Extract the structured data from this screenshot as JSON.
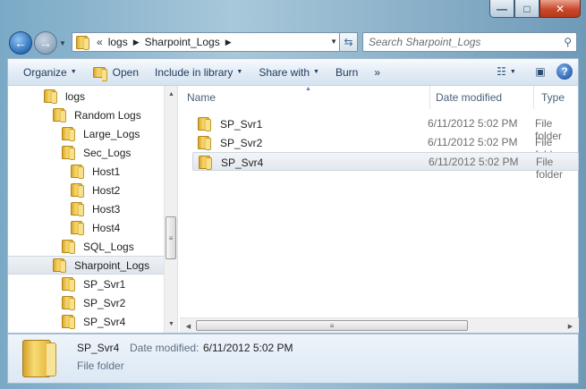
{
  "window": {
    "buttons": {
      "minimize": "—",
      "maximize": "□",
      "close": "✕"
    }
  },
  "address_bar": {
    "overflow": "«",
    "segments": [
      "logs",
      "Sharpoint_Logs"
    ]
  },
  "search": {
    "placeholder": "Search Sharpoint_Logs"
  },
  "toolbar": {
    "organize": "Organize",
    "open": "Open",
    "include_in_library": "Include in library",
    "share_with": "Share with",
    "burn": "Burn",
    "more": "»",
    "help": "?"
  },
  "nav_tree": [
    {
      "label": "logs",
      "level": 0
    },
    {
      "label": "Random Logs",
      "level": 1
    },
    {
      "label": "Large_Logs",
      "level": 2
    },
    {
      "label": "Sec_Logs",
      "level": 2
    },
    {
      "label": "Host1",
      "level": 3
    },
    {
      "label": "Host2",
      "level": 3
    },
    {
      "label": "Host3",
      "level": 3
    },
    {
      "label": "Host4",
      "level": 3
    },
    {
      "label": "SQL_Logs",
      "level": 2
    },
    {
      "label": "Sharpoint_Logs",
      "level": 1,
      "selected": true
    },
    {
      "label": "SP_Svr1",
      "level": 2
    },
    {
      "label": "SP_Svr2",
      "level": 2
    },
    {
      "label": "SP_Svr4",
      "level": 2
    }
  ],
  "columns": {
    "name": "Name",
    "date_modified": "Date modified",
    "type": "Type"
  },
  "files": [
    {
      "name": "SP_Svr1",
      "date_modified": "6/11/2012 5:02 PM",
      "type": "File folder"
    },
    {
      "name": "SP_Svr2",
      "date_modified": "6/11/2012 5:02 PM",
      "type": "File folder"
    },
    {
      "name": "SP_Svr4",
      "date_modified": "6/11/2012 5:02 PM",
      "type": "File folder",
      "selected": true
    }
  ],
  "details": {
    "name": "SP_Svr4",
    "modified_label": "Date modified:",
    "modified_value": "6/11/2012 5:02 PM",
    "type": "File folder"
  },
  "colors": {
    "selection": "#e3e8ee",
    "toolbar_text": "#1e395b",
    "folder": "#f5d66b"
  }
}
